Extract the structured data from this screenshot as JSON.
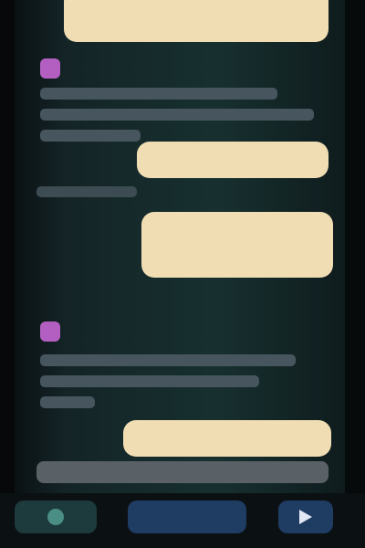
{
  "thread": {
    "messages": [
      {
        "type": "outgoing",
        "text": ""
      },
      {
        "type": "incoming",
        "sender": "",
        "text": ""
      },
      {
        "type": "outgoing",
        "text": ""
      },
      {
        "type": "outgoing",
        "text": ""
      },
      {
        "type": "incoming",
        "sender": "",
        "text": ""
      },
      {
        "type": "outgoing",
        "text": ""
      }
    ]
  },
  "composer": {
    "text": ""
  },
  "bottom_bar": {
    "attach_icon": "attach-icon",
    "center_label": "",
    "send_icon": "send-icon"
  },
  "colors": {
    "outgoing_bubble": "#f1ddb3",
    "sender_accent": "#b35fc1",
    "background": "#17302f",
    "primary_button": "#1f3c63"
  }
}
